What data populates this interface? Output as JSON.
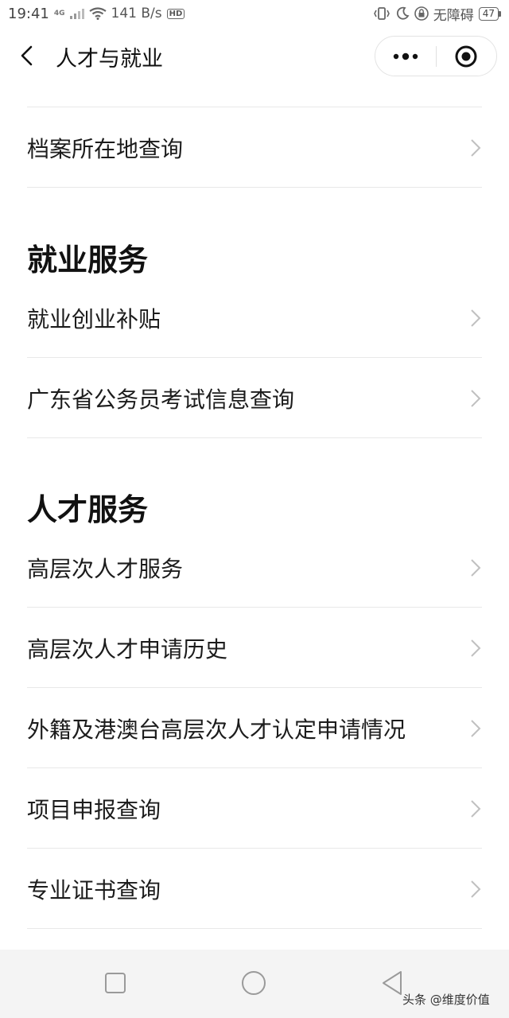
{
  "status_bar": {
    "time": "19:41",
    "network_type": "4G",
    "speed": "141 B/s",
    "hd_label": "HD",
    "accessibility_text": "无障碍",
    "battery": "47"
  },
  "nav": {
    "title": "人才与就业"
  },
  "top_items": [
    {
      "label": "档案所在地查询"
    }
  ],
  "sections": [
    {
      "title": "就业服务",
      "items": [
        {
          "label": "就业创业补贴"
        },
        {
          "label": "广东省公务员考试信息查询"
        }
      ]
    },
    {
      "title": "人才服务",
      "items": [
        {
          "label": "高层次人才服务"
        },
        {
          "label": "高层次人才申请历史"
        },
        {
          "label": "外籍及港澳台高层次人才认定申请情况"
        },
        {
          "label": "项目申报查询"
        },
        {
          "label": "专业证书查询"
        }
      ]
    }
  ],
  "watermark": "头条 @维度价值",
  "icons": {
    "back": "back-icon",
    "more": "more-dots-icon",
    "close": "miniprogram-close-icon",
    "chevron": "chevron-right-icon",
    "home": "square-icon",
    "circle": "circle-icon",
    "back_triangle": "triangle-back-icon"
  },
  "colors": {
    "text": "#1c1c1c",
    "divider": "#e8e8e8",
    "chevron": "#c0c0c0",
    "nav_bar_bg": "#f4f4f4"
  }
}
